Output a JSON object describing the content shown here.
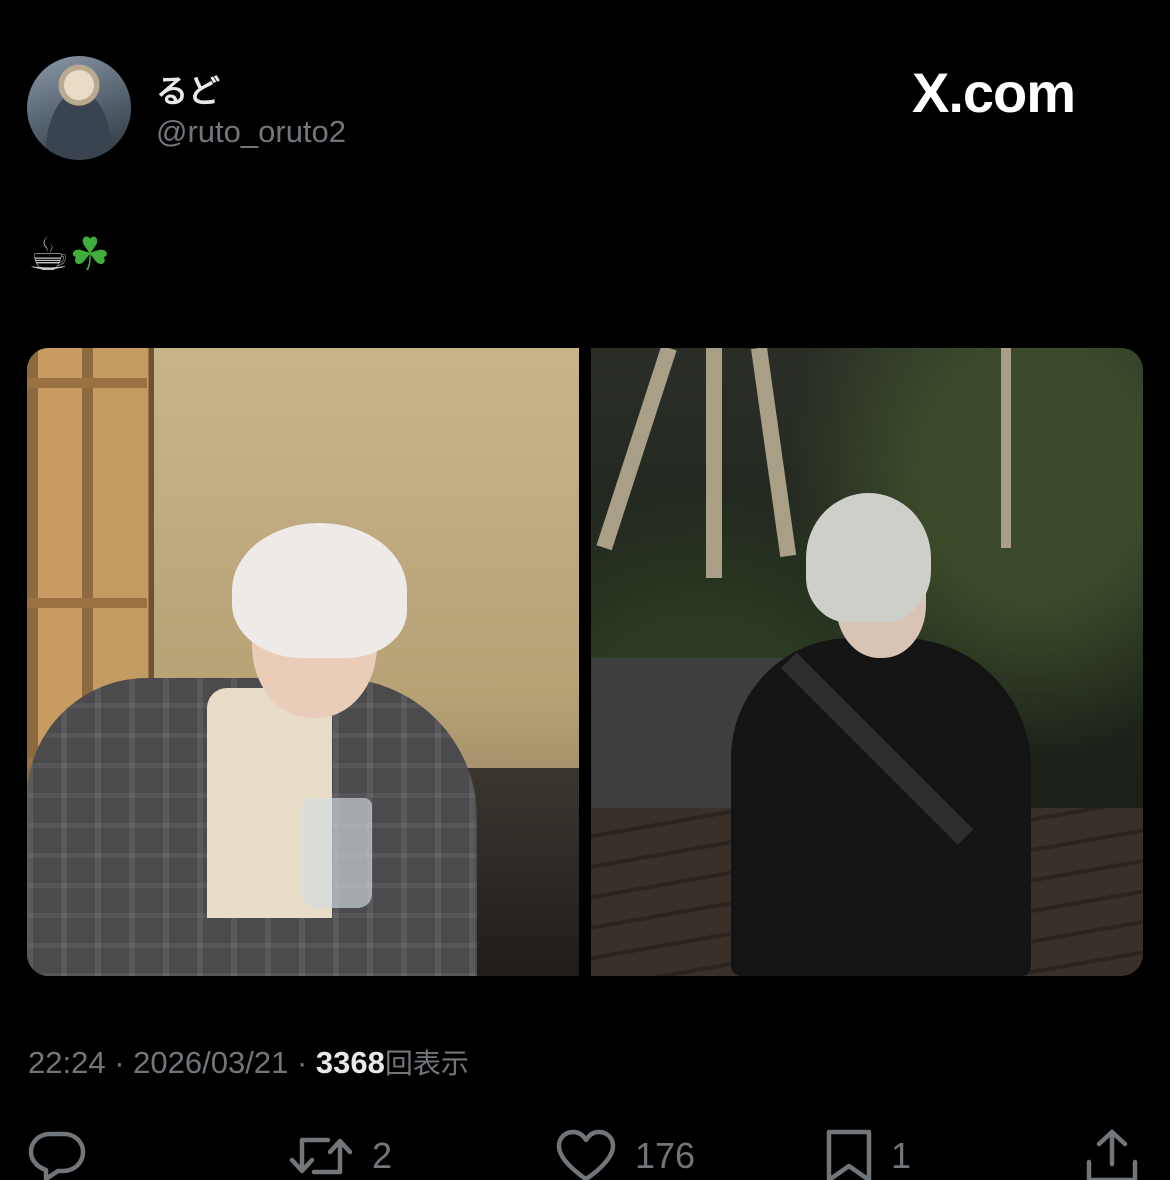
{
  "author": {
    "display_name": "るど",
    "handle": "@ruto_oruto2"
  },
  "brand": "X.com",
  "post": {
    "text_emoji": [
      "☕",
      "☘"
    ],
    "images": [
      {
        "icon": "photo-cafe"
      },
      {
        "icon": "photo-garden-night"
      }
    ]
  },
  "meta": {
    "time": "22:24",
    "separator": "·",
    "date": "2026/03/21",
    "views_count": "3368",
    "views_label": "回表示"
  },
  "actions": {
    "reply": {
      "icon": "reply-icon",
      "count": ""
    },
    "repost": {
      "icon": "repost-icon",
      "count": "2"
    },
    "like": {
      "icon": "like-icon",
      "count": "176"
    },
    "bookmark": {
      "icon": "bookmark-icon",
      "count": "1"
    },
    "share": {
      "icon": "share-icon",
      "count": ""
    }
  },
  "colors": {
    "background": "#000000",
    "text_primary": "#e7e9ea",
    "text_secondary": "#71767b"
  }
}
